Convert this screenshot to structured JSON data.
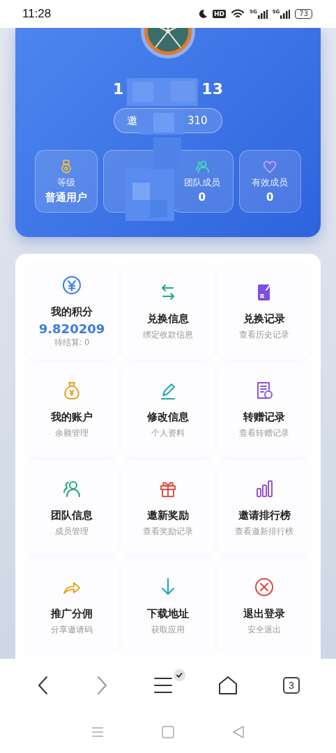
{
  "status_bar": {
    "time": "11:28",
    "hd_label": "HD",
    "networks": [
      "5G",
      "5G"
    ],
    "battery": "73"
  },
  "profile": {
    "account_parts": [
      "1",
      "13"
    ],
    "invite_parts": [
      "邀",
      "310"
    ],
    "stats": [
      {
        "kind": "stat",
        "label": "等级",
        "value": "普通用户"
      },
      {
        "kind": "blurred"
      },
      {
        "kind": "stat",
        "label": "团队成员",
        "value": "0"
      },
      {
        "kind": "stat",
        "label": "有效成员",
        "value": "0"
      }
    ]
  },
  "menu": [
    {
      "title": "我的积分",
      "value": "9.820209",
      "note": "待结算: 0"
    },
    {
      "title": "兑换信息",
      "subtitle": "绑定收款信息"
    },
    {
      "title": "兑换记录",
      "subtitle": "查看历史记录"
    },
    {
      "title": "我的账户",
      "subtitle": "余额管理"
    },
    {
      "title": "修改信息",
      "subtitle": "个人资料"
    },
    {
      "title": "转赠记录",
      "subtitle": "查看转赠记录"
    },
    {
      "title": "团队信息",
      "subtitle": "成员管理"
    },
    {
      "title": "邀新奖励",
      "subtitle": "查看奖励记录"
    },
    {
      "title": "邀请排行榜",
      "subtitle": "查看邀新排行榜"
    },
    {
      "title": "推广分佣",
      "subtitle": "分享邀请码"
    },
    {
      "title": "下载地址",
      "subtitle": "获取应用"
    },
    {
      "title": "退出登录",
      "subtitle": "安全退出"
    }
  ],
  "browser_bar": {
    "tab_count": "3"
  }
}
